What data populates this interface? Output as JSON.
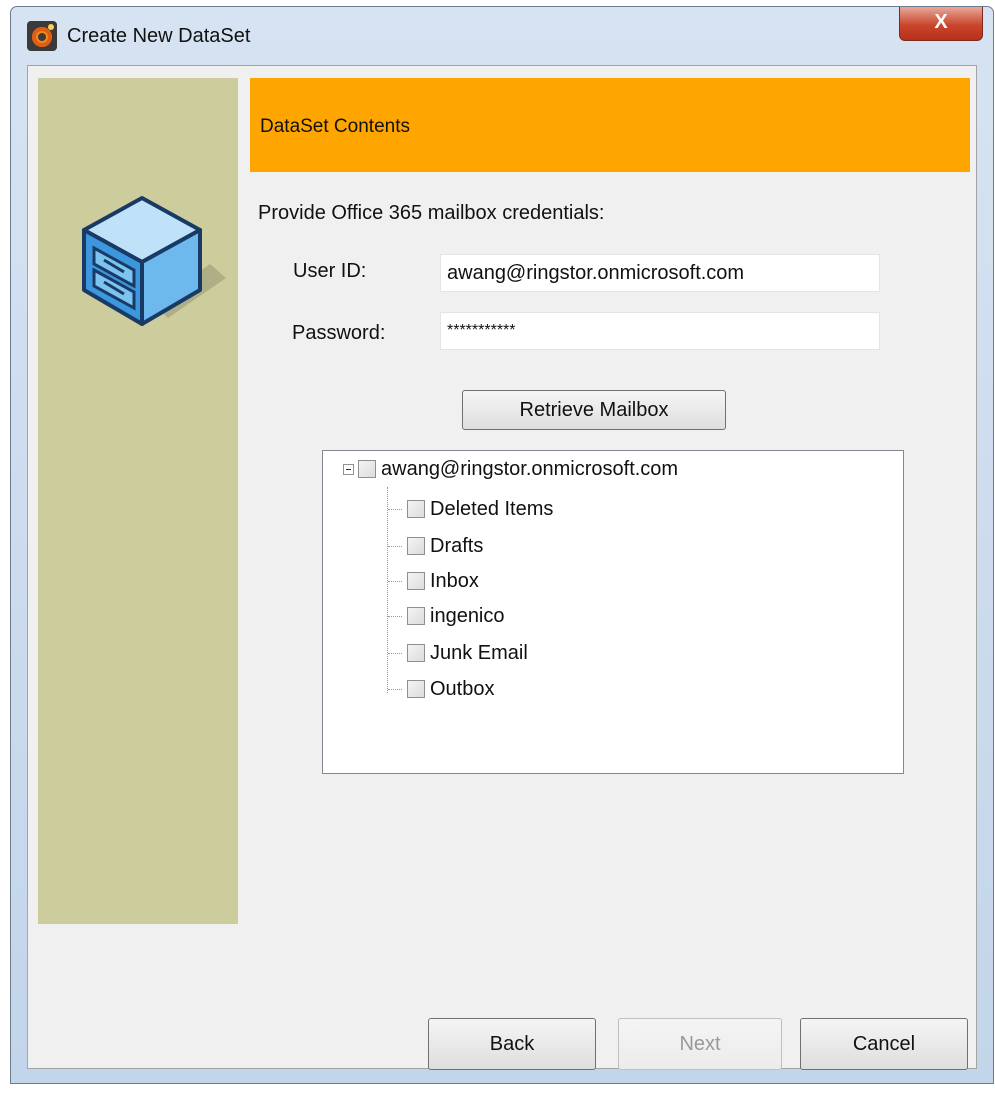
{
  "window": {
    "title": "Create New DataSet",
    "close_glyph": "X"
  },
  "header": {
    "title": "DataSet Contents"
  },
  "form": {
    "instructions": "Provide Office 365 mailbox credentials:",
    "user_id_label": "User ID:",
    "user_id_value": "awang@ringstor.onmicrosoft.com",
    "password_label": "Password:",
    "password_value": "***********",
    "retrieve_label": "Retrieve Mailbox"
  },
  "tree": {
    "root": {
      "label": "awang@ringstor.onmicrosoft.com",
      "expanded": true,
      "checked": false
    },
    "children": [
      {
        "label": "Deleted Items",
        "checked": false
      },
      {
        "label": "Drafts",
        "checked": false
      },
      {
        "label": "Inbox",
        "checked": false
      },
      {
        "label": "ingenico",
        "checked": false
      },
      {
        "label": "Junk Email",
        "checked": false
      },
      {
        "label": "Outbox",
        "checked": false
      }
    ]
  },
  "buttons": {
    "back": "Back",
    "next": "Next",
    "next_enabled": false,
    "cancel": "Cancel"
  },
  "colors": {
    "header_band": "#ffa500",
    "side_panel": "#cccc9c",
    "dialog_bg": "#f0f0f0",
    "close_button": "#c9462c"
  },
  "icons": {
    "app": "app-logo-icon",
    "side": "file-cabinet-icon",
    "tree_toggle": "collapse-minus-icon"
  }
}
